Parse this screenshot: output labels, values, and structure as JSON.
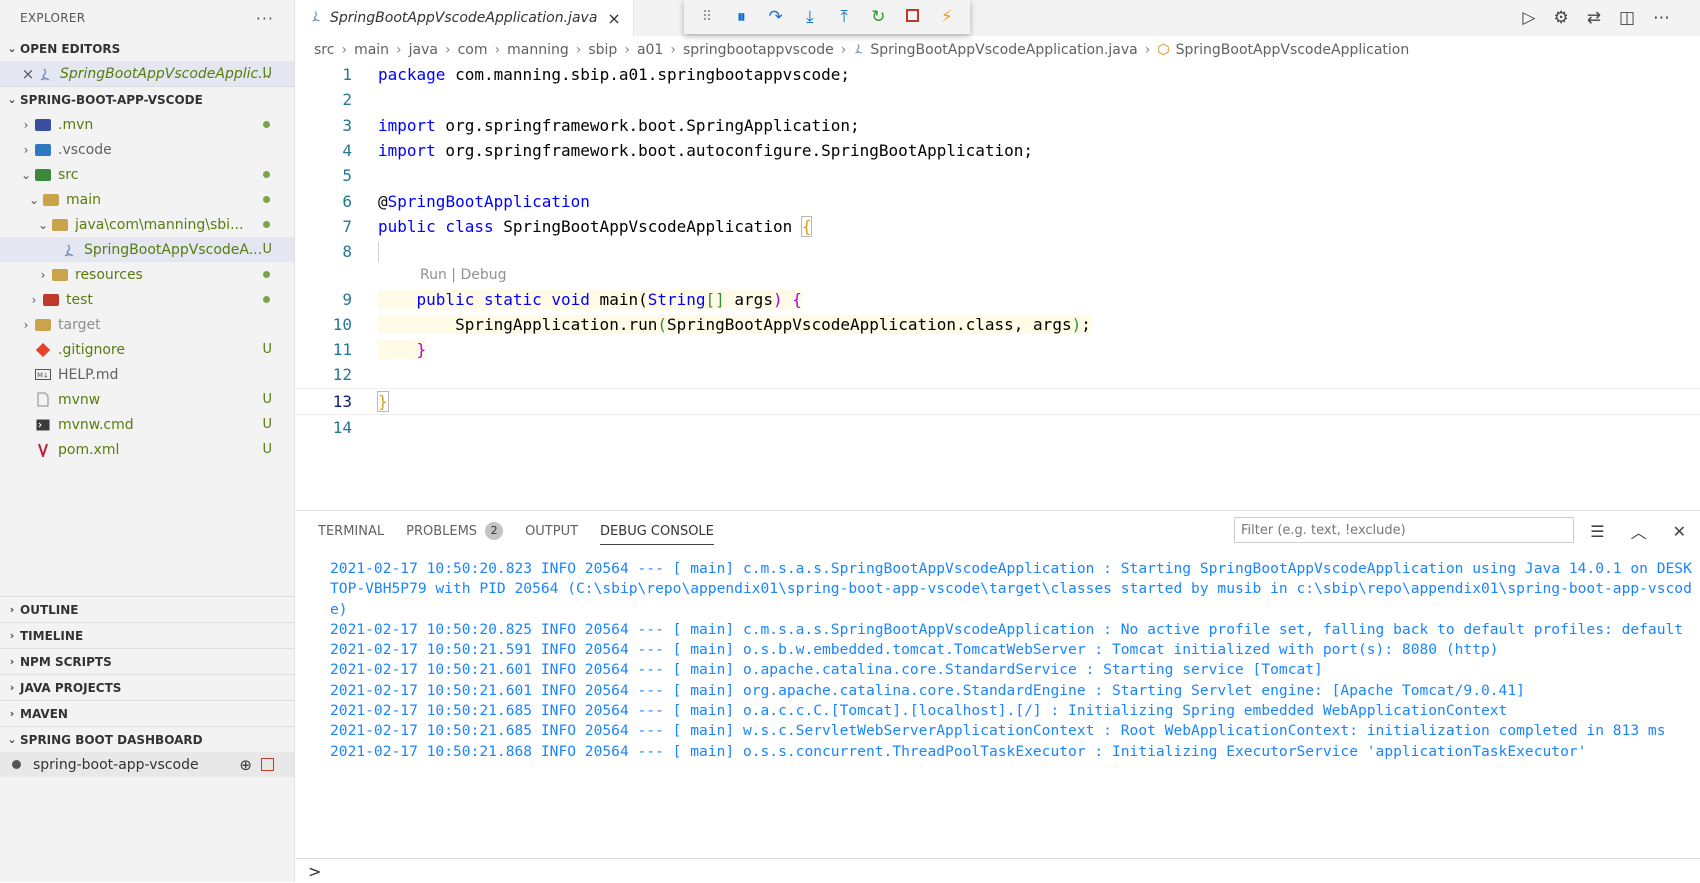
{
  "sidebar": {
    "title": "EXPLORER",
    "more": "···",
    "open_editors": {
      "header": "OPEN EDITORS",
      "file": "SpringBootAppVscodeApplic...",
      "badge": "U"
    },
    "project": {
      "header": "SPRING-BOOT-APP-VSCODE",
      "items": [
        {
          "label": ".mvn",
          "badge": ""
        },
        {
          "label": ".vscode",
          "badge": ""
        },
        {
          "label": "src",
          "badge": ""
        },
        {
          "label": "main",
          "badge": ""
        },
        {
          "label": "java\\com\\manning\\sbi...",
          "badge": ""
        },
        {
          "label": "SpringBootAppVscodeA...",
          "badge": "U"
        },
        {
          "label": "resources",
          "badge": ""
        },
        {
          "label": "test",
          "badge": ""
        },
        {
          "label": "target",
          "badge": ""
        },
        {
          "label": ".gitignore",
          "badge": "U"
        },
        {
          "label": "HELP.md",
          "badge": ""
        },
        {
          "label": "mvnw",
          "badge": "U"
        },
        {
          "label": "mvnw.cmd",
          "badge": "U"
        },
        {
          "label": "pom.xml",
          "badge": "U"
        }
      ]
    },
    "sections": [
      "OUTLINE",
      "TIMELINE",
      "NPM SCRIPTS",
      "JAVA PROJECTS",
      "MAVEN"
    ],
    "dashboard": {
      "header": "SPRING BOOT DASHBOARD",
      "app": "spring-boot-app-vscode"
    }
  },
  "editor": {
    "tab": "SpringBootAppVscodeApplication.java",
    "tab_close": "×",
    "breadcrumb": [
      "src",
      "main",
      "java",
      "com",
      "manning",
      "sbip",
      "a01",
      "springbootappvscode",
      "SpringBootAppVscodeApplication.java",
      "SpringBootAppVscodeApplication"
    ],
    "codelens": "Run | Debug",
    "lines": {
      "l1_kw": "package",
      "l1_rest": " com.manning.sbip.a01.springbootappvscode;",
      "l3_kw": "import",
      "l3_rest": " org.springframework.boot.SpringApplication;",
      "l4_kw": "import",
      "l4_rest": " org.springframework.boot.autoconfigure.SpringBootApplication;",
      "l6_at": "@",
      "l6_ann": "SpringBootApplication",
      "l7_kw": "public class",
      "l7_rest": " SpringBootAppVscodeApplication ",
      "l7_brace": "{",
      "l9_indent": "    ",
      "l9_kw": "public static void",
      "l9_rest": " main(",
      "l9_type": "String",
      "l9_br": "[]",
      "l9_rest2": " args",
      "l9_par": ")",
      "l9_brace": " {",
      "l10_indent": "        ",
      "l10_rest": "SpringApplication.run",
      "l10_par": "(",
      "l10_rest2": "SpringBootAppVscodeApplication.class, args",
      "l10_par2": ")",
      "l10_end": ";",
      "l11_indent": "    ",
      "l11_brace": "}",
      "l13_brace": "}"
    }
  },
  "panel": {
    "tabs": [
      "TERMINAL",
      "PROBLEMS",
      "OUTPUT",
      "DEBUG CONSOLE"
    ],
    "problems_count": "2",
    "filter_placeholder": "Filter (e.g. text, !exclude)",
    "log": [
      "2021-02-17 10:50:20.823  INFO 20564 --- [           main] c.m.s.a.s.SpringBootAppVscodeApplication : Starting SpringBootAppVscodeApplication using Java 14.0.1 on DESKTOP-VBH5P79 with PID 20564 (C:\\sbip\\repo\\appendix01\\spring-boot-app-vscode\\target\\classes started by musib in c:\\sbip\\repo\\appendix01\\spring-boot-app-vscode)",
      "2021-02-17 10:50:20.825  INFO 20564 --- [           main] c.m.s.a.s.SpringBootAppVscodeApplication : No active profile set, falling back to default profiles: default",
      "2021-02-17 10:50:21.591  INFO 20564 --- [           main] o.s.b.w.embedded.tomcat.TomcatWebServer  : Tomcat initialized with port(s): 8080 (http)",
      "2021-02-17 10:50:21.601  INFO 20564 --- [           main] o.apache.catalina.core.StandardService   : Starting service [Tomcat]",
      "2021-02-17 10:50:21.601  INFO 20564 --- [           main] org.apache.catalina.core.StandardEngine  : Starting Servlet engine: [Apache Tomcat/9.0.41]",
      "2021-02-17 10:50:21.685  INFO 20564 --- [           main] o.a.c.c.C.[Tomcat].[localhost].[/]       : Initializing Spring embedded WebApplicationContext",
      "2021-02-17 10:50:21.685  INFO 20564 --- [           main] w.s.c.ServletWebServerApplicationContext : Root WebApplicationContext: initialization completed in 813 ms",
      "2021-02-17 10:50:21.868  INFO 20564 --- [           main] o.s.s.concurrent.ThreadPoolTaskExecutor  : Initializing ExecutorService 'applicationTaskExecutor'"
    ],
    "prompt": ">"
  }
}
